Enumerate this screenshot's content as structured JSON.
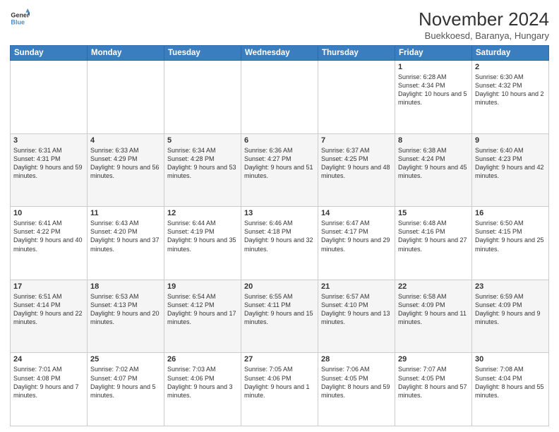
{
  "logo": {
    "line1": "General",
    "line2": "Blue"
  },
  "title": "November 2024",
  "location": "Buekkoesd, Baranya, Hungary",
  "headers": [
    "Sunday",
    "Monday",
    "Tuesday",
    "Wednesday",
    "Thursday",
    "Friday",
    "Saturday"
  ],
  "weeks": [
    [
      {
        "day": "",
        "text": ""
      },
      {
        "day": "",
        "text": ""
      },
      {
        "day": "",
        "text": ""
      },
      {
        "day": "",
        "text": ""
      },
      {
        "day": "",
        "text": ""
      },
      {
        "day": "1",
        "text": "Sunrise: 6:28 AM\nSunset: 4:34 PM\nDaylight: 10 hours and 5 minutes."
      },
      {
        "day": "2",
        "text": "Sunrise: 6:30 AM\nSunset: 4:32 PM\nDaylight: 10 hours and 2 minutes."
      }
    ],
    [
      {
        "day": "3",
        "text": "Sunrise: 6:31 AM\nSunset: 4:31 PM\nDaylight: 9 hours and 59 minutes."
      },
      {
        "day": "4",
        "text": "Sunrise: 6:33 AM\nSunset: 4:29 PM\nDaylight: 9 hours and 56 minutes."
      },
      {
        "day": "5",
        "text": "Sunrise: 6:34 AM\nSunset: 4:28 PM\nDaylight: 9 hours and 53 minutes."
      },
      {
        "day": "6",
        "text": "Sunrise: 6:36 AM\nSunset: 4:27 PM\nDaylight: 9 hours and 51 minutes."
      },
      {
        "day": "7",
        "text": "Sunrise: 6:37 AM\nSunset: 4:25 PM\nDaylight: 9 hours and 48 minutes."
      },
      {
        "day": "8",
        "text": "Sunrise: 6:38 AM\nSunset: 4:24 PM\nDaylight: 9 hours and 45 minutes."
      },
      {
        "day": "9",
        "text": "Sunrise: 6:40 AM\nSunset: 4:23 PM\nDaylight: 9 hours and 42 minutes."
      }
    ],
    [
      {
        "day": "10",
        "text": "Sunrise: 6:41 AM\nSunset: 4:22 PM\nDaylight: 9 hours and 40 minutes."
      },
      {
        "day": "11",
        "text": "Sunrise: 6:43 AM\nSunset: 4:20 PM\nDaylight: 9 hours and 37 minutes."
      },
      {
        "day": "12",
        "text": "Sunrise: 6:44 AM\nSunset: 4:19 PM\nDaylight: 9 hours and 35 minutes."
      },
      {
        "day": "13",
        "text": "Sunrise: 6:46 AM\nSunset: 4:18 PM\nDaylight: 9 hours and 32 minutes."
      },
      {
        "day": "14",
        "text": "Sunrise: 6:47 AM\nSunset: 4:17 PM\nDaylight: 9 hours and 29 minutes."
      },
      {
        "day": "15",
        "text": "Sunrise: 6:48 AM\nSunset: 4:16 PM\nDaylight: 9 hours and 27 minutes."
      },
      {
        "day": "16",
        "text": "Sunrise: 6:50 AM\nSunset: 4:15 PM\nDaylight: 9 hours and 25 minutes."
      }
    ],
    [
      {
        "day": "17",
        "text": "Sunrise: 6:51 AM\nSunset: 4:14 PM\nDaylight: 9 hours and 22 minutes."
      },
      {
        "day": "18",
        "text": "Sunrise: 6:53 AM\nSunset: 4:13 PM\nDaylight: 9 hours and 20 minutes."
      },
      {
        "day": "19",
        "text": "Sunrise: 6:54 AM\nSunset: 4:12 PM\nDaylight: 9 hours and 17 minutes."
      },
      {
        "day": "20",
        "text": "Sunrise: 6:55 AM\nSunset: 4:11 PM\nDaylight: 9 hours and 15 minutes."
      },
      {
        "day": "21",
        "text": "Sunrise: 6:57 AM\nSunset: 4:10 PM\nDaylight: 9 hours and 13 minutes."
      },
      {
        "day": "22",
        "text": "Sunrise: 6:58 AM\nSunset: 4:09 PM\nDaylight: 9 hours and 11 minutes."
      },
      {
        "day": "23",
        "text": "Sunrise: 6:59 AM\nSunset: 4:09 PM\nDaylight: 9 hours and 9 minutes."
      }
    ],
    [
      {
        "day": "24",
        "text": "Sunrise: 7:01 AM\nSunset: 4:08 PM\nDaylight: 9 hours and 7 minutes."
      },
      {
        "day": "25",
        "text": "Sunrise: 7:02 AM\nSunset: 4:07 PM\nDaylight: 9 hours and 5 minutes."
      },
      {
        "day": "26",
        "text": "Sunrise: 7:03 AM\nSunset: 4:06 PM\nDaylight: 9 hours and 3 minutes."
      },
      {
        "day": "27",
        "text": "Sunrise: 7:05 AM\nSunset: 4:06 PM\nDaylight: 9 hours and 1 minute."
      },
      {
        "day": "28",
        "text": "Sunrise: 7:06 AM\nSunset: 4:05 PM\nDaylight: 8 hours and 59 minutes."
      },
      {
        "day": "29",
        "text": "Sunrise: 7:07 AM\nSunset: 4:05 PM\nDaylight: 8 hours and 57 minutes."
      },
      {
        "day": "30",
        "text": "Sunrise: 7:08 AM\nSunset: 4:04 PM\nDaylight: 8 hours and 55 minutes."
      }
    ]
  ]
}
